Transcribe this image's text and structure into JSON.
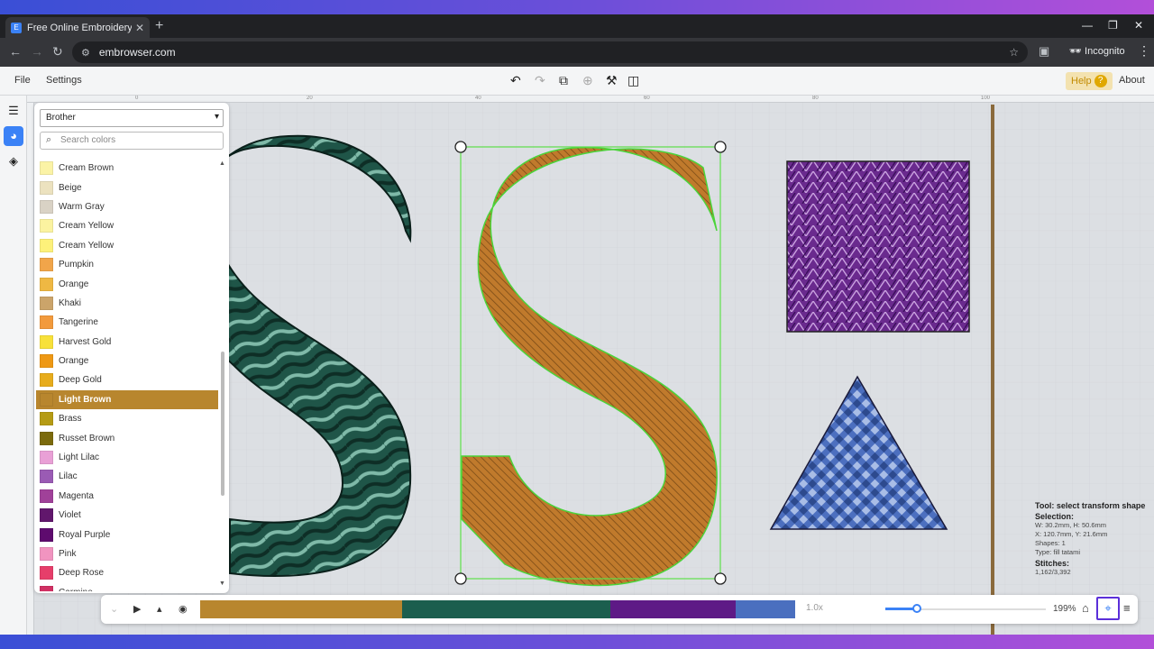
{
  "browser": {
    "tab_title": "Free Online Embroidery Softwa",
    "url": "embrowser.com",
    "incognito_label": "Incognito"
  },
  "menubar": {
    "file": "File",
    "settings": "Settings",
    "help": "Help",
    "about": "About"
  },
  "color_panel": {
    "brand": "Brother",
    "search_placeholder": "Search colors",
    "colors": [
      {
        "name": "Cream Brown",
        "hex": "#fbf3a6"
      },
      {
        "name": "Beige",
        "hex": "#ece2bf"
      },
      {
        "name": "Warm Gray",
        "hex": "#d9d2c5"
      },
      {
        "name": "Cream Yellow",
        "hex": "#fbf3a0"
      },
      {
        "name": "Cream Yellow",
        "hex": "#fdf17a"
      },
      {
        "name": "Pumpkin",
        "hex": "#f1a54a"
      },
      {
        "name": "Orange",
        "hex": "#efb843"
      },
      {
        "name": "Khaki",
        "hex": "#cba46a"
      },
      {
        "name": "Tangerine",
        "hex": "#f29a3c"
      },
      {
        "name": "Harvest Gold",
        "hex": "#f8e13a"
      },
      {
        "name": "Orange",
        "hex": "#ee9814"
      },
      {
        "name": "Deep Gold",
        "hex": "#e7ac1c"
      },
      {
        "name": "Light Brown",
        "hex": "#b8862e"
      },
      {
        "name": "Brass",
        "hex": "#b59b14"
      },
      {
        "name": "Russet Brown",
        "hex": "#7b6a0c"
      },
      {
        "name": "Light Lilac",
        "hex": "#e9a0d6"
      },
      {
        "name": "Lilac",
        "hex": "#9a5bb4"
      },
      {
        "name": "Magenta",
        "hex": "#a04199"
      },
      {
        "name": "Violet",
        "hex": "#61176c"
      },
      {
        "name": "Royal Purple",
        "hex": "#5e0b6e"
      },
      {
        "name": "Pink",
        "hex": "#f194c0"
      },
      {
        "name": "Deep Rose",
        "hex": "#e63e6a"
      },
      {
        "name": "Carmine",
        "hex": "#d13063"
      }
    ],
    "selected_index": 12
  },
  "info": {
    "tool": "Tool: select transform shape",
    "selection_label": "Selection:",
    "size": "W: 30.2mm, H: 50.6mm",
    "position": "X: 120.7mm, Y: 21.6mm",
    "shapes": "Shapes: 1",
    "type": "Type: fill tatami",
    "stitches_label": "Stitches:",
    "stitches": "1,162/3,392"
  },
  "playback": {
    "speed": "1.0x",
    "zoom": "199%",
    "zoom_level": 0.2,
    "segments": [
      {
        "color": "#b8862e",
        "fraction": 0.34
      },
      {
        "color": "#1b5e4e",
        "fraction": 0.35
      },
      {
        "color": "#5e1a86",
        "fraction": 0.21
      },
      {
        "color": "#4a6fbf",
        "fraction": 0.1
      }
    ]
  },
  "ruler": {
    "ticks": [
      "0",
      "20",
      "40",
      "60",
      "80",
      "100"
    ]
  },
  "colors": {
    "accent": "#3b82f6",
    "selection_outline": "#5ee04a",
    "s_left": "#1f5548",
    "s_center": "#c07a2c",
    "square": "#6a2a8e",
    "triangle": "#4c6fbf"
  }
}
